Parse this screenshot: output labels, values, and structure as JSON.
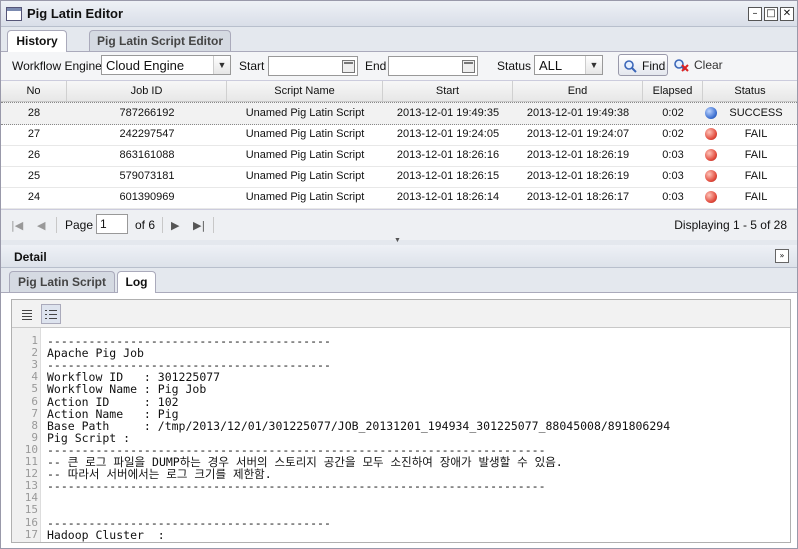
{
  "window": {
    "title": "Pig Latin Editor"
  },
  "tabs": [
    "History",
    "Pig Latin Script Editor"
  ],
  "filters": {
    "engine_label": "Workflow Engine",
    "engine_value": "Cloud Engine",
    "start_label": "Start",
    "start_value": "",
    "end_label": "End",
    "end_value": "",
    "status_label": "Status",
    "status_value": "ALL",
    "find_label": "Find",
    "clear_label": "Clear"
  },
  "grid": {
    "columns": [
      "No",
      "Job ID",
      "Script Name",
      "Start",
      "End",
      "Elapsed",
      "Status"
    ],
    "rows": [
      {
        "no": "28",
        "job_id": "787266192",
        "script": "Unamed Pig Latin Script",
        "start": "2013-12-01 19:49:35",
        "end": "2013-12-01 19:49:38",
        "elapsed": "0:02",
        "status": "SUCCESS",
        "status_color": "#3c6fd0"
      },
      {
        "no": "27",
        "job_id": "242297547",
        "script": "Unamed Pig Latin Script",
        "start": "2013-12-01 19:24:05",
        "end": "2013-12-01 19:24:07",
        "elapsed": "0:02",
        "status": "FAIL",
        "status_color": "#e0483a"
      },
      {
        "no": "26",
        "job_id": "863161088",
        "script": "Unamed Pig Latin Script",
        "start": "2013-12-01 18:26:16",
        "end": "2013-12-01 18:26:19",
        "elapsed": "0:03",
        "status": "FAIL",
        "status_color": "#e0483a"
      },
      {
        "no": "25",
        "job_id": "579073181",
        "script": "Unamed Pig Latin Script",
        "start": "2013-12-01 18:26:15",
        "end": "2013-12-01 18:26:19",
        "elapsed": "0:03",
        "status": "FAIL",
        "status_color": "#e0483a"
      },
      {
        "no": "24",
        "job_id": "601390969",
        "script": "Unamed Pig Latin Script",
        "start": "2013-12-01 18:26:14",
        "end": "2013-12-01 18:26:17",
        "elapsed": "0:03",
        "status": "FAIL",
        "status_color": "#e0483a"
      }
    ]
  },
  "pager": {
    "page_label": "Page",
    "page_value": "1",
    "of_label": "of 6",
    "display_text": "Displaying 1 - 5 of 28"
  },
  "detail": {
    "title": "Detail",
    "tabs": [
      "Pig Latin Script",
      "Log"
    ],
    "log_lines": [
      "-----------------------------------------",
      "Apache Pig Job",
      "-----------------------------------------",
      "Workflow ID   : 301225077",
      "Workflow Name : Pig Job",
      "Action ID     : 102",
      "Action Name   : Pig",
      "Base Path     : /tmp/2013/12/01/301225077/JOB_20131201_194934_301225077_88045008/891806294",
      "Pig Script :",
      "------------------------------------------------------------------------",
      "-- 큰 로그 파일을 DUMP하는 경우 서버의 스토리지 공간을 모두 소진하여 장애가 발생할 수 있음.",
      "-- 따라서 서버에서는 로그 크기를 제한함.",
      "------------------------------------------------------------------------",
      "",
      "",
      "-----------------------------------------",
      "Hadoop Cluster  :"
    ]
  }
}
